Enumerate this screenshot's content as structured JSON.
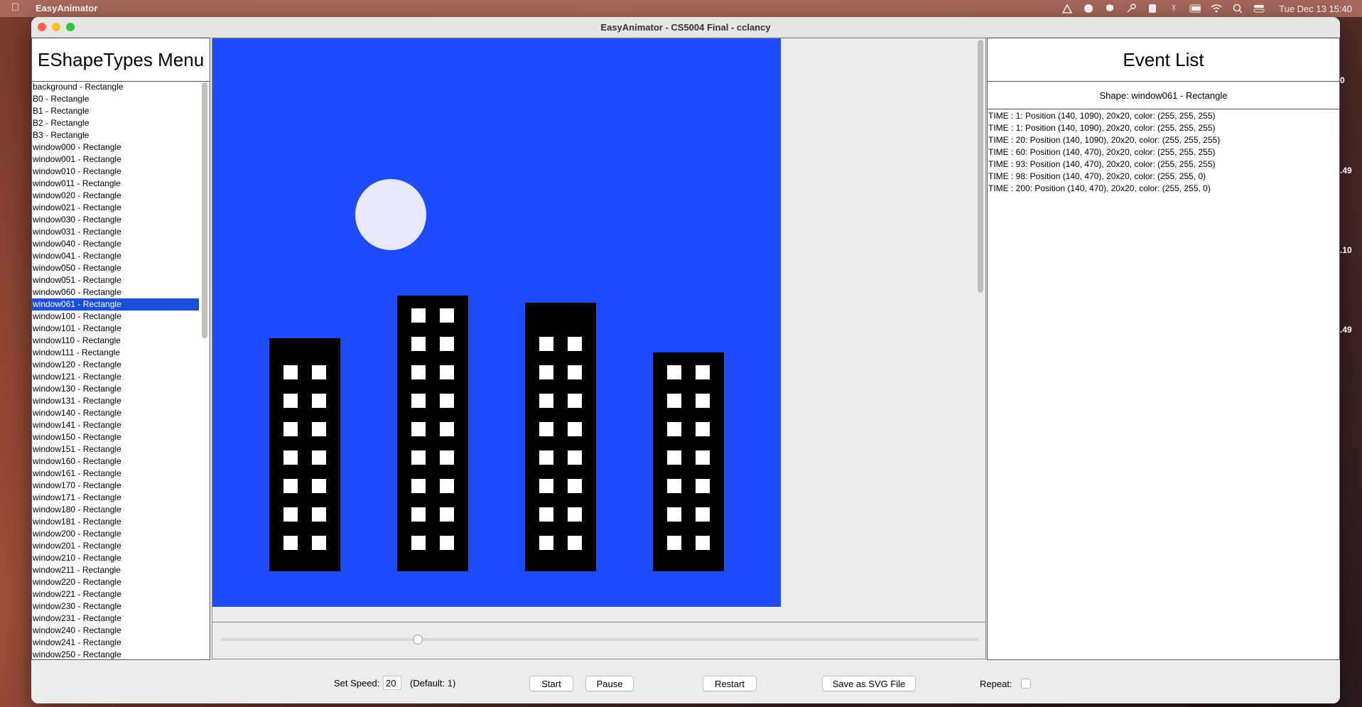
{
  "menubar": {
    "app_name": "EasyAnimator",
    "clock": "Tue Dec 13  15:40"
  },
  "window": {
    "title": "EasyAnimator - CS5004 Final - cclancy"
  },
  "shape_menu": {
    "title": "EShapeTypes Menu",
    "selected_index": 18,
    "items": [
      "background - Rectangle",
      "B0 - Rectangle",
      "B1 - Rectangle",
      "B2 - Rectangle",
      "B3 - Rectangle",
      "window000 - Rectangle",
      "window001 - Rectangle",
      "window010 - Rectangle",
      "window011 - Rectangle",
      "window020 - Rectangle",
      "window021 - Rectangle",
      "window030 - Rectangle",
      "window031 - Rectangle",
      "window040 - Rectangle",
      "window041 - Rectangle",
      "window050 - Rectangle",
      "window051 - Rectangle",
      "window060 - Rectangle",
      "window061 - Rectangle",
      "window100 - Rectangle",
      "window101 - Rectangle",
      "window110 - Rectangle",
      "window111 - Rectangle",
      "window120 - Rectangle",
      "window121 - Rectangle",
      "window130 - Rectangle",
      "window131 - Rectangle",
      "window140 - Rectangle",
      "window141 - Rectangle",
      "window150 - Rectangle",
      "window151 - Rectangle",
      "window160 - Rectangle",
      "window161 - Rectangle",
      "window170 - Rectangle",
      "window171 - Rectangle",
      "window180 - Rectangle",
      "window181 - Rectangle",
      "window200 - Rectangle",
      "window201 - Rectangle",
      "window210 - Rectangle",
      "window211 - Rectangle",
      "window220 - Rectangle",
      "window221 - Rectangle",
      "window230 - Rectangle",
      "window231 - Rectangle",
      "window240 - Rectangle",
      "window241 - Rectangle",
      "window250 - Rectangle"
    ]
  },
  "event_panel": {
    "title": "Event List",
    "shape_label": "Shape: window061 - Rectangle",
    "events": [
      "TIME : 1: Position (140, 1090), 20x20, color: (255, 255, 255)",
      "TIME : 1: Position (140, 1090), 20x20, color: (255, 255, 255)",
      "TIME : 20: Position (140, 1090), 20x20, color: (255, 255, 255)",
      "TIME : 60: Position (140, 470), 20x20, color: (255, 255, 255)",
      "TIME : 93: Position (140, 470), 20x20, color: (255, 255, 255)",
      "TIME : 98: Position (140, 470), 20x20, color: (255, 255, 0)",
      "TIME : 200: Position (140, 470), 20x20, color: (255, 255, 0)"
    ]
  },
  "canvas": {
    "sky_color": "#1f4bff",
    "moon_color": "#e8e8fa",
    "building_color": "#000000",
    "window_color": "#ffffff",
    "buildings": [
      {
        "name": "B0",
        "window_rows": 7
      },
      {
        "name": "B1",
        "window_rows": 9
      },
      {
        "name": "B2",
        "window_rows": 8
      },
      {
        "name": "B3",
        "window_rows": 7
      }
    ]
  },
  "playback": {
    "progress": 0.26
  },
  "controls": {
    "speed_label": "Set Speed:",
    "speed_value": "20",
    "default_label": "(Default: 1)",
    "start_label": "Start",
    "pause_label": "Pause",
    "restart_label": "Restart",
    "save_svg_label": "Save as SVG File",
    "repeat_label": "Repeat:",
    "repeat_checked": false
  },
  "desktop_peek": [
    "0",
    ".49",
    ".10",
    ".49"
  ]
}
